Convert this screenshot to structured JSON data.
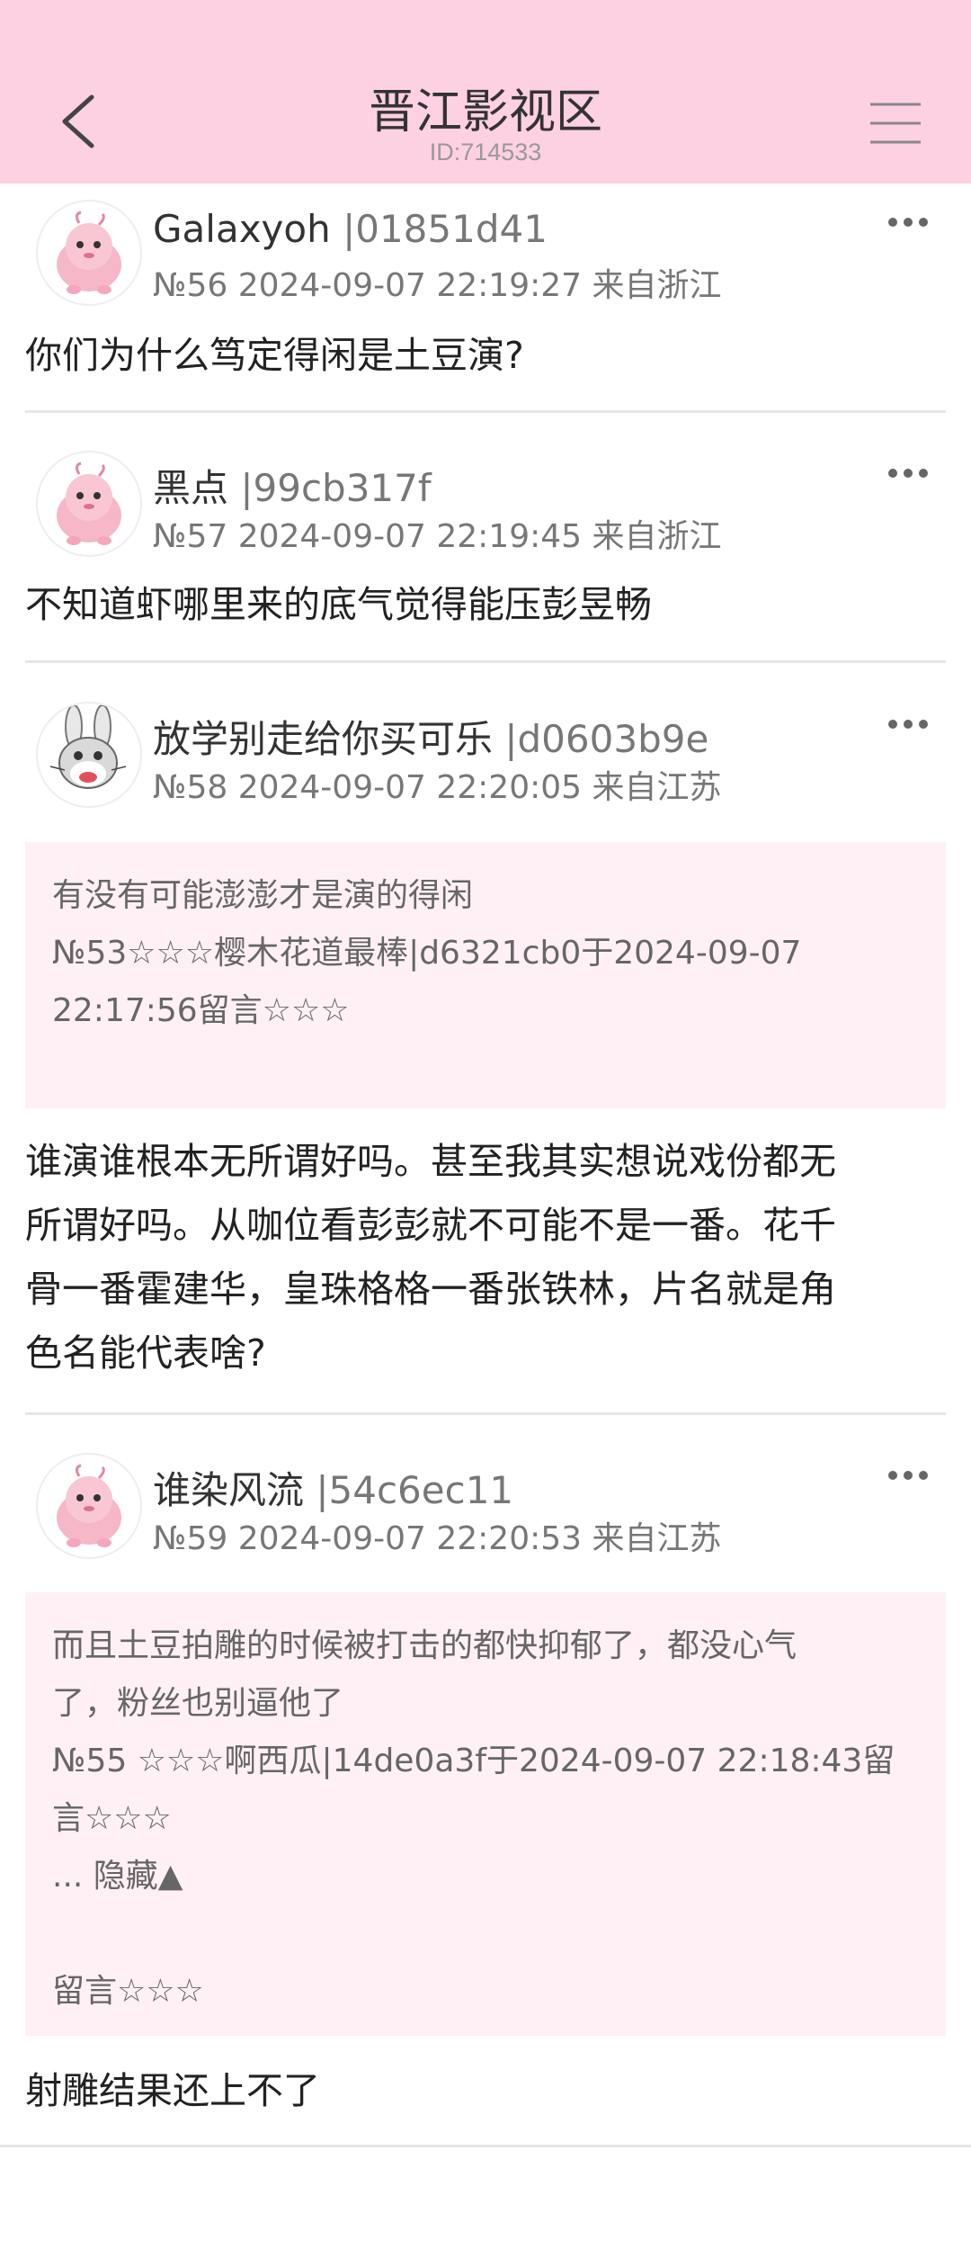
{
  "header": {
    "title": "晋江影视区",
    "subtitle": "ID:714533"
  },
  "posts": [
    {
      "name": "Galaxyoh",
      "hash": " |01851d41",
      "meta": "№56 2024-09-07 22:19:27 来自浙江",
      "content": "你们为什么笃定得闲是土豆演?",
      "avatar": "pink-pig-avatar"
    },
    {
      "name": "黑点",
      "hash": " |99cb317f",
      "meta": "№57 2024-09-07 22:19:45 来自浙江",
      "content": "不知道虾哪里来的底气觉得能压彭昱畅",
      "avatar": "pink-pig-avatar"
    },
    {
      "name": "放学别走给你买可乐",
      "hash": " |d0603b9e",
      "meta": "№58 2024-09-07 22:20:05 来自江苏",
      "quote_lines": [
        "有没有可能澎澎才是演的得闲",
        "№53☆☆☆樱木花道最棒|d6321cb0于2024-09-07",
        "22:17:56留言☆☆☆"
      ],
      "content_lines": [
        "谁演谁根本无所谓好吗。甚至我其实想说戏份都无",
        "所谓好吗。从咖位看彭彭就不可能不是一番。花千",
        "骨一番霍建华，皇珠格格一番张铁林，片名就是角",
        "色名能代表啥?"
      ],
      "avatar": "bunny-avatar"
    },
    {
      "name": "谁染风流",
      "hash": " |54c6ec11",
      "meta": "№59 2024-09-07 22:20:53 来自江苏",
      "quote_lines": [
        "而且土豆拍雕的时候被打击的都快抑郁了，都没心气",
        "了，粉丝也别逼他了",
        "№55 ☆☆☆啊西瓜|14de0a3f于2024-09-07 22:18:43留",
        "言☆☆☆",
        "... 隐藏▲",
        "",
        "留言☆☆☆"
      ],
      "content": "射雕结果还上不了",
      "avatar": "pink-pig-avatar"
    }
  ]
}
